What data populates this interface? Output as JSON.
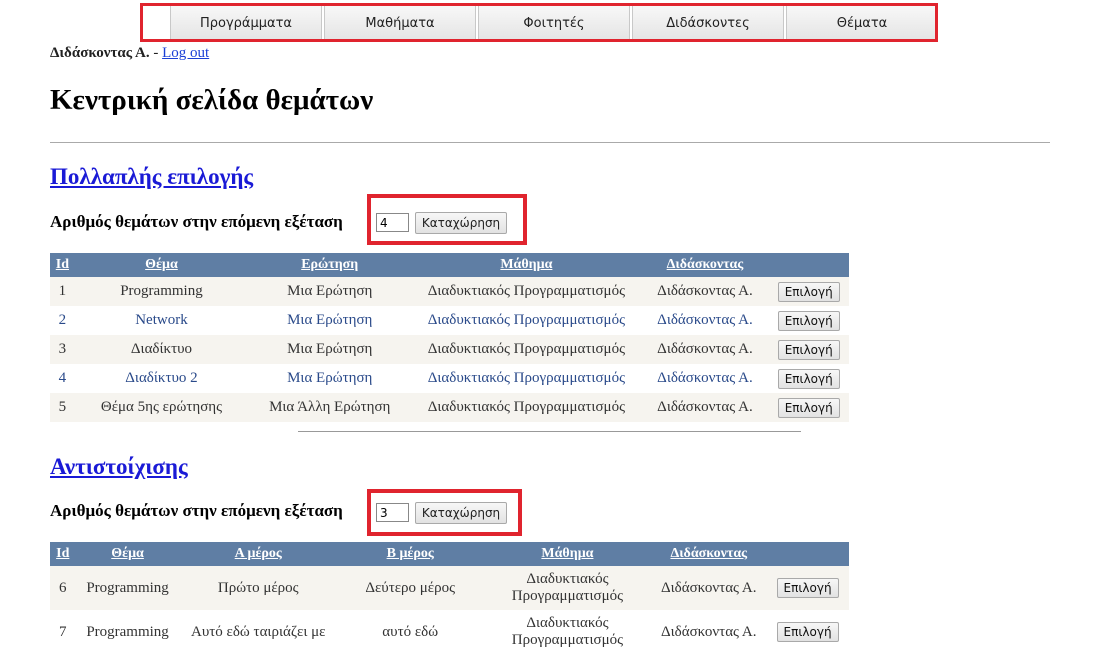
{
  "nav": {
    "items": [
      {
        "label": "Προγράμματα"
      },
      {
        "label": "Μαθήματα"
      },
      {
        "label": "Φοιτητές"
      },
      {
        "label": "Διδάσκοντες"
      },
      {
        "label": "Θέματα"
      }
    ]
  },
  "user": {
    "name": "Διδάσκοντας Α.",
    "separator": " - ",
    "logout": "Log out"
  },
  "page_title": "Κεντρική σελίδα θεμάτων",
  "multiple_choice": {
    "title": "Πολλαπλής επιλογής",
    "count_label": "Αριθμός θεμάτων στην επόμενη εξέταση",
    "count_value": "4",
    "submit": "Καταχώρηση",
    "headers": [
      "Id",
      "Θέμα",
      "Ερώτηση",
      "Μάθημα",
      "Διδάσκοντας"
    ],
    "rows": [
      {
        "id": "1",
        "topic": "Programming",
        "question": "Μια Ερώτηση",
        "course": "Διαδυκτιακός Προγραμματισμός",
        "teacher": "Διδάσκοντας Α.",
        "action": "Επιλογή"
      },
      {
        "id": "2",
        "topic": "Network",
        "question": "Μια Ερώτηση",
        "course": "Διαδυκτιακός Προγραμματισμός",
        "teacher": "Διδάσκοντας Α.",
        "action": "Επιλογή"
      },
      {
        "id": "3",
        "topic": "Διαδίκτυο",
        "question": "Μια Ερώτηση",
        "course": "Διαδυκτιακός Προγραμματισμός",
        "teacher": "Διδάσκοντας Α.",
        "action": "Επιλογή"
      },
      {
        "id": "4",
        "topic": "Διαδίκτυο 2",
        "question": "Μια Ερώτηση",
        "course": "Διαδυκτιακός Προγραμματισμός",
        "teacher": "Διδάσκοντας Α.",
        "action": "Επιλογή"
      },
      {
        "id": "5",
        "topic": "Θέμα 5ης ερώτησης",
        "question": "Μια Άλλη Ερώτηση",
        "course": "Διαδυκτιακός Προγραμματισμός",
        "teacher": "Διδάσκοντας Α.",
        "action": "Επιλογή"
      }
    ]
  },
  "matching": {
    "title": "Αντιστοίχισης",
    "count_label": "Αριθμός θεμάτων στην επόμενη εξέταση",
    "count_value": "3",
    "submit": "Καταχώρηση",
    "headers": [
      "Id",
      "Θέμα",
      "Α μέρος",
      "Β μέρος",
      "Μάθημα",
      "Διδάσκοντας"
    ],
    "rows": [
      {
        "id": "6",
        "topic": "Programming",
        "part_a": "Πρώτο μέρος",
        "part_b": "Δεύτερο μέρος",
        "course": "Διαδυκτιακός Προγραμματισμός",
        "teacher": "Διδάσκοντας Α.",
        "action": "Επιλογή"
      },
      {
        "id": "7",
        "topic": "Programming",
        "part_a": "Αυτό εδώ ταιριάζει με",
        "part_b": "αυτό εδώ",
        "course": "Διαδυκτιακός Προγραμματισμός",
        "teacher": "Διδάσκοντας Α.",
        "action": "Επιλογή"
      }
    ]
  }
}
